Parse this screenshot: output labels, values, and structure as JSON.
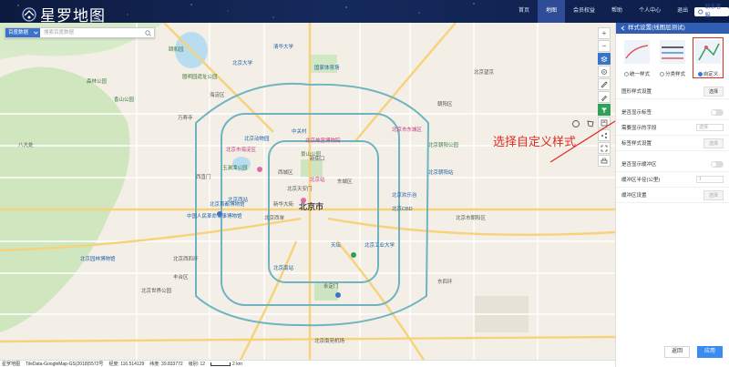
{
  "header": {
    "app_name": "星罗地图",
    "nav": [
      "首页",
      "地图",
      "会员权益",
      "帮助",
      "个人中心",
      "退出"
    ],
    "active_nav": "地图",
    "service": "联系客服"
  },
  "search": {
    "source_label": "百度数据",
    "placeholder": "搜索百度数据"
  },
  "map_labels": {
    "center": "北京市",
    "places": [
      "中关村",
      "北京西站",
      "北京南站",
      "丰台区",
      "海淀区",
      "朝阳区",
      "东城区",
      "西城区",
      "北京大学",
      "清华大学",
      "圆明园遗址公园",
      "国家体育场",
      "北京市海淀区",
      "北京动物园",
      "中国人民革命军事博物馆",
      "北京市东城区",
      "北京朝阳站",
      "北京工业大学",
      "北京站",
      "北京欢乐谷",
      "北京CBD",
      "天坛",
      "新街口",
      "西直门",
      "北京西四环",
      "东四环",
      "北京园林博物馆",
      "八大处",
      "森林公园",
      "香山公园",
      "颐和园",
      "玉渊潭公园",
      "北京世界公园",
      "北京南苑机场",
      "永定门",
      "北京朝阳公园",
      "北京西单",
      "北京望京",
      "北京首都博物馆",
      "北京天安门",
      "景山公园",
      "新华大街",
      "北京故宫博物院",
      "北京市朝阳区",
      "万寿寺"
    ]
  },
  "annotation": "选择自定义样式",
  "statusbar": {
    "logo": "星罗地图",
    "source": "TileData-GoogleMap-GS(2018)5572号",
    "lng": "经度: 116.514129",
    "lat": "纬度: 39.833772",
    "zoom": "级别: 12",
    "scale": "2 km"
  },
  "panel": {
    "title": "样式设置(线图层测试)",
    "styles": [
      {
        "label": "统一样式",
        "selected": false
      },
      {
        "label": "分类样式",
        "selected": false
      },
      {
        "label": "自定义",
        "selected": true
      }
    ],
    "rows": [
      {
        "label": "图形样式设置",
        "control": "button",
        "value": "选择"
      },
      {
        "label": "是否显示标签",
        "control": "toggle"
      },
      {
        "label": "需要显示的字段",
        "control": "select",
        "value": "选择"
      },
      {
        "label": "标签样式设置",
        "control": "button",
        "value": "选择",
        "disabled": true
      },
      {
        "label": "是否显示缓冲区",
        "control": "toggle"
      },
      {
        "label": "缓冲区半径(公里)",
        "control": "number",
        "value": "1"
      },
      {
        "label": "缓冲区设置",
        "control": "button",
        "value": "选择",
        "disabled": true
      }
    ],
    "footer": {
      "back": "返回",
      "apply": "应用"
    }
  },
  "colors": {
    "accent": "#2f5eb3",
    "ring_road": "#6fb4c0",
    "road_major": "#f7d27a",
    "annotation": "#e02b1f"
  }
}
